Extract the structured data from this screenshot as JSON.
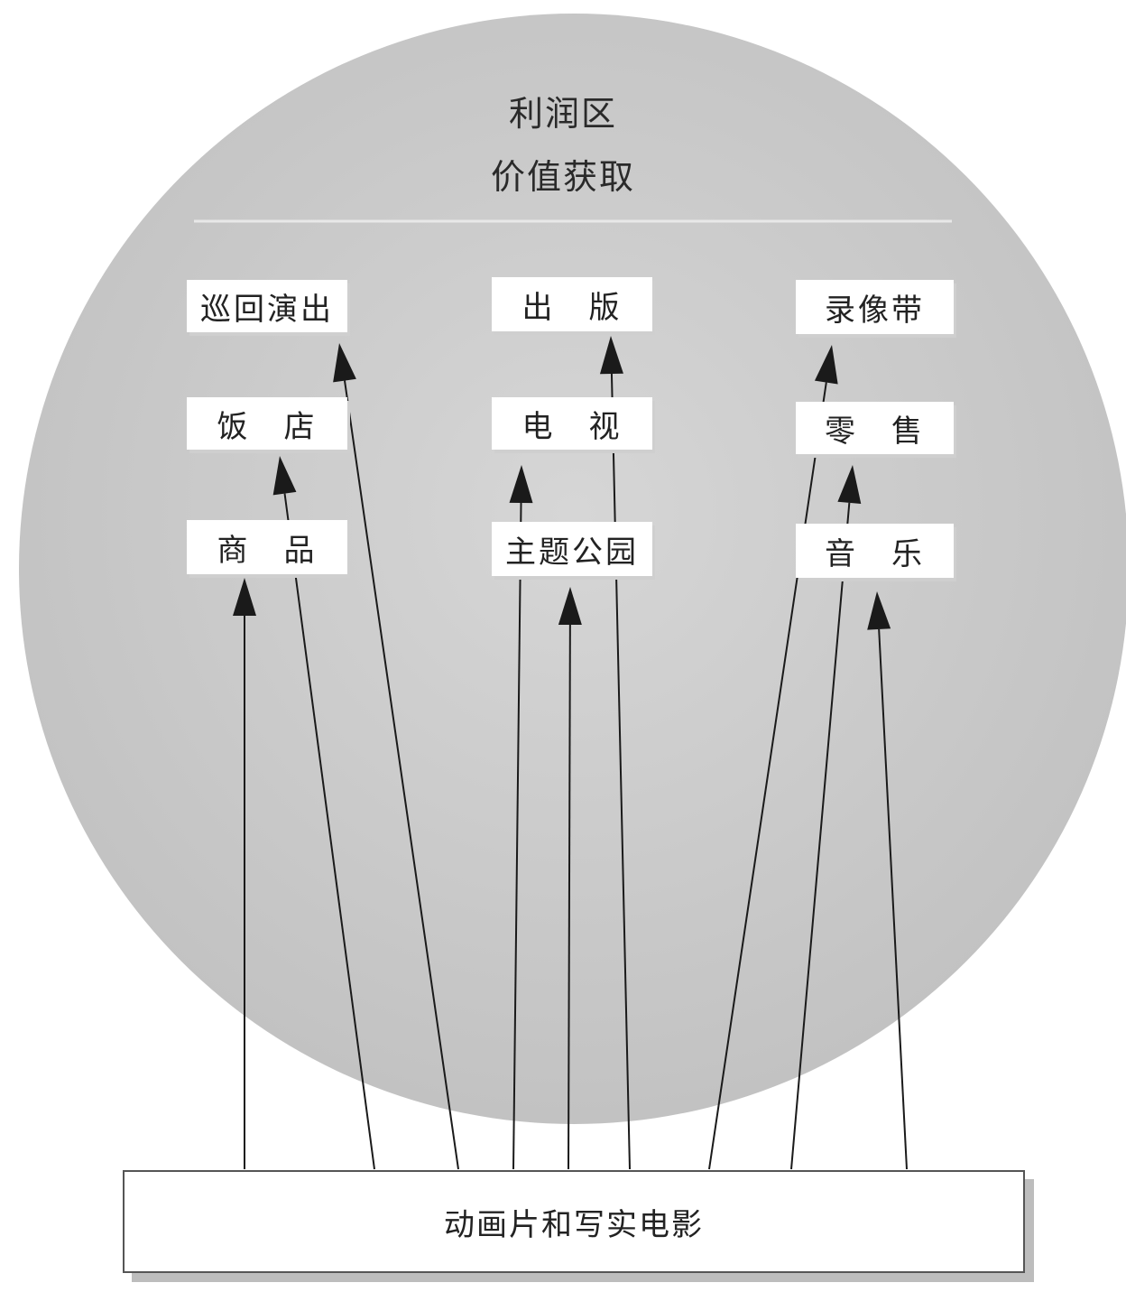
{
  "region": {
    "title": "利润区",
    "subtitle": "价值获取"
  },
  "nodes": {
    "tour": "巡回演出",
    "publishing": "出　版",
    "video": "录像带",
    "hotel": "饭　店",
    "tv": "电　视",
    "retail": "零　售",
    "merch": "商　品",
    "themepark": "主题公园",
    "music": "音　乐"
  },
  "base": {
    "label": "动画片和写实电影"
  },
  "colors": {
    "circle": "#c9c9c9",
    "node_bg": "#ffffff",
    "line": "#1a1a1a"
  }
}
